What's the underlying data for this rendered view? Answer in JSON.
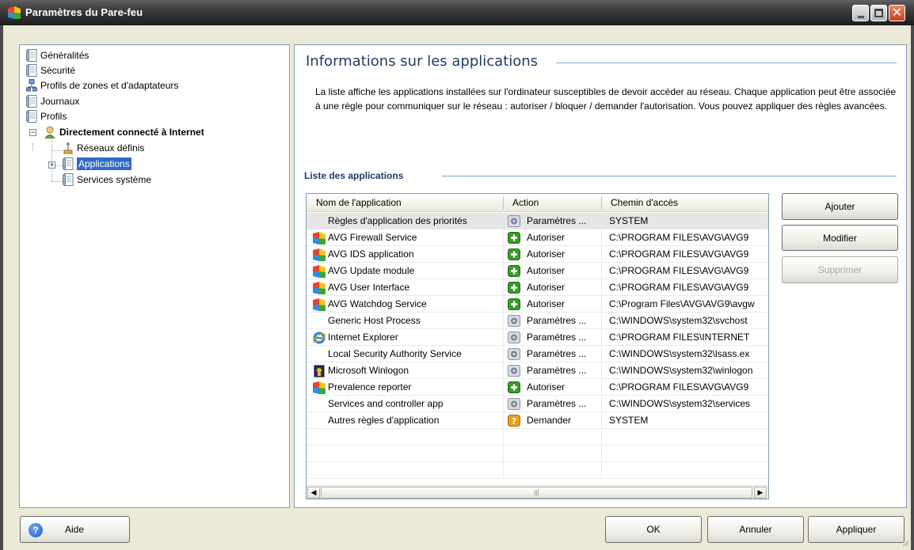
{
  "window": {
    "title": "Paramètres du Pare-feu",
    "controls": [
      "minimize-icon",
      "maximize-icon",
      "close-icon"
    ]
  },
  "tree": {
    "items": [
      {
        "label": "Généralités",
        "icon": "document-icon"
      },
      {
        "label": "Sécurité",
        "icon": "document-icon"
      },
      {
        "label": "Profils de zones et d'adaptateurs",
        "icon": "network-icon"
      },
      {
        "label": "Journaux",
        "icon": "document-icon"
      },
      {
        "label": "Profils",
        "icon": "document-icon"
      },
      {
        "label": "Directement connecté à Internet",
        "icon": "user-icon",
        "bold": true,
        "expanded": true
      },
      {
        "label": "Réseaux définis",
        "icon": "network-icon"
      },
      {
        "label": "Applications",
        "icon": "document-icon",
        "selected": true
      },
      {
        "label": "Services système",
        "icon": "document-icon"
      }
    ]
  },
  "main": {
    "heading": "Informations sur les applications",
    "description": "La liste affiche les applications installées sur l'ordinateur susceptibles de devoir accéder au réseau. Chaque application peut être associée à une règle pour communiquer sur le réseau : autoriser / bloquer / demander l'autorisation. Vous pouvez appliquer des règles avancées.",
    "list_heading": "Liste des applications",
    "columns": [
      "Nom de l'application",
      "Action",
      "Chemin d'accès"
    ],
    "rows": [
      {
        "name": "Règles d'application des priorités",
        "icon": "",
        "action": "Paramètres ...",
        "action_icon": "gear-icon",
        "path": "SYSTEM",
        "selected": true
      },
      {
        "name": "AVG Firewall Service",
        "icon": "avg-logo-icon",
        "action": "Autoriser",
        "action_icon": "allow-icon",
        "path": "C:\\PROGRAM FILES\\AVG\\AVG9"
      },
      {
        "name": "AVG IDS application",
        "icon": "avg-logo-icon",
        "action": "Autoriser",
        "action_icon": "allow-icon",
        "path": "C:\\PROGRAM FILES\\AVG\\AVG9"
      },
      {
        "name": "AVG Update module",
        "icon": "avg-logo-icon",
        "action": "Autoriser",
        "action_icon": "allow-icon",
        "path": "C:\\PROGRAM FILES\\AVG\\AVG9"
      },
      {
        "name": "AVG User Interface",
        "icon": "avg-logo-icon",
        "action": "Autoriser",
        "action_icon": "allow-icon",
        "path": "C:\\PROGRAM FILES\\AVG\\AVG9"
      },
      {
        "name": "AVG Watchdog Service",
        "icon": "avg-logo-icon",
        "action": "Autoriser",
        "action_icon": "allow-icon",
        "path": "C:\\Program Files\\AVG\\AVG9\\avgw"
      },
      {
        "name": "Generic Host Process",
        "icon": "",
        "action": "Paramètres ...",
        "action_icon": "gear-icon",
        "path": "C:\\WINDOWS\\system32\\svchost"
      },
      {
        "name": "Internet Explorer",
        "icon": "internet-explorer-icon",
        "action": "Paramètres ...",
        "action_icon": "gear-icon",
        "path": "C:\\PROGRAM FILES\\INTERNET"
      },
      {
        "name": "Local Security Authority Service",
        "icon": "",
        "action": "Paramètres ...",
        "action_icon": "gear-icon",
        "path": "C:\\WINDOWS\\system32\\lsass.ex"
      },
      {
        "name": "Microsoft Winlogon",
        "icon": "winlogon-icon",
        "action": "Paramètres ...",
        "action_icon": "gear-icon",
        "path": "C:\\WINDOWS\\system32\\winlogon"
      },
      {
        "name": "Prevalence reporter",
        "icon": "avg-logo-icon",
        "action": "Autoriser",
        "action_icon": "allow-icon",
        "path": "C:\\PROGRAM FILES\\AVG\\AVG9"
      },
      {
        "name": "Services and controller app",
        "icon": "",
        "action": "Paramètres ...",
        "action_icon": "gear-icon",
        "path": "C:\\WINDOWS\\system32\\services"
      },
      {
        "name": "Autres règles d'application",
        "icon": "",
        "action": "Demander",
        "action_icon": "ask-icon",
        "path": "SYSTEM"
      }
    ],
    "buttons": {
      "add": "Ajouter",
      "edit": "Modifier",
      "delete": "Supprimer"
    }
  },
  "footer": {
    "help": "Aide",
    "ok": "OK",
    "cancel": "Annuler",
    "apply": "Appliquer"
  },
  "colors": {
    "heading": "#1f3c6a",
    "selection": "#316ac5",
    "allow": "#3a9b2c",
    "ask": "#e8a21a"
  }
}
